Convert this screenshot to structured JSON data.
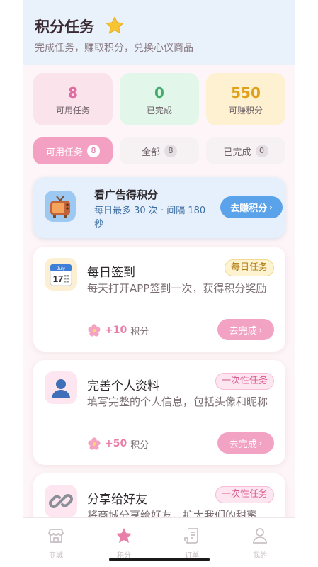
{
  "header": {
    "title": "积分任务",
    "subtitle": "完成任务，赚取积分，兑换心仪商品"
  },
  "stats": [
    {
      "value": "8",
      "label": "可用任务",
      "bg": "#fbe3ec",
      "color": "#e06c9f"
    },
    {
      "value": "0",
      "label": "已完成",
      "bg": "#e2f6ea",
      "color": "#3fae6a"
    },
    {
      "value": "550",
      "label": "可赚积分",
      "bg": "#fdf1d2",
      "color": "#e0a019"
    }
  ],
  "filters": [
    {
      "label": "可用任务",
      "count": "8",
      "active": true
    },
    {
      "label": "全部",
      "count": "8",
      "active": false
    },
    {
      "label": "已完成",
      "count": "0",
      "active": false
    }
  ],
  "ad": {
    "title": "看广告得积分",
    "desc": "每日最多 30 次 · 间隔 180 秒",
    "button": "去赚积分",
    "icon": "tv-icon"
  },
  "tasks": [
    {
      "title": "每日签到",
      "tag": "每日任务",
      "desc": "每天打开APP签到一次，获得积分奖励",
      "points": "+10",
      "unit": "积分",
      "button": "去完成",
      "icon": "calendar-icon"
    },
    {
      "title": "完善个人资料",
      "tag": "一次性任务",
      "desc": "填写完整的个人信息，包括头像和昵称",
      "points": "+50",
      "unit": "积分",
      "button": "去完成",
      "icon": "user-icon"
    },
    {
      "title": "分享给好友",
      "tag": "一次性任务",
      "desc": "将商城分享给好友，扩大我们的甜蜜",
      "icon": "link-icon"
    }
  ],
  "tabbar": [
    {
      "label": "商城",
      "icon": "store-icon",
      "active": false
    },
    {
      "label": "积分",
      "icon": "star-icon",
      "active": true
    },
    {
      "label": "订单",
      "icon": "orders-icon",
      "active": false
    },
    {
      "label": "我的",
      "icon": "user-icon",
      "active": false
    }
  ],
  "colors": {
    "accent_pink": "#e77fa8",
    "button_pink": "#f2a3c3",
    "accent_blue": "#5aa2ea",
    "daily_tag_bg": "#fdf3d0",
    "onetime_tag_bg": "#fde6ef"
  }
}
